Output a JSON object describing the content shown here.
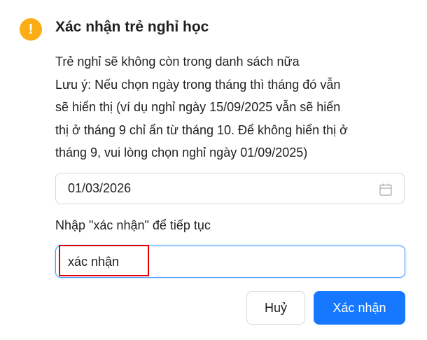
{
  "dialog": {
    "icon": "exclamation-circle-icon",
    "title": "Xác nhận trẻ nghỉ học",
    "description_lines": [
      "Trẻ nghỉ sẽ không còn trong danh sách nữa",
      "Lưu ý: Nếu chọn ngày trong tháng thì tháng đó vẫn",
      "sẽ hiển thị (ví dụ nghỉ ngày 15/09/2025 vẫn sẽ hiển",
      "thị ở tháng 9 chỉ ẩn từ tháng 10. Để không hiển thị ở",
      "tháng 9, vui lòng chọn nghỉ ngày 01/09/2025)"
    ],
    "date_picker": {
      "value": "01/03/2026",
      "icon": "calendar-icon"
    },
    "confirm_label": "Nhập \"xác nhận\" để tiếp tục",
    "confirm_input": {
      "value": "xác nhận"
    },
    "buttons": {
      "cancel": "Huỷ",
      "ok": "Xác nhận"
    },
    "colors": {
      "warning": "#faad14",
      "primary": "#1677ff",
      "focus_border": "#4096ff",
      "highlight": "#e00000"
    }
  }
}
